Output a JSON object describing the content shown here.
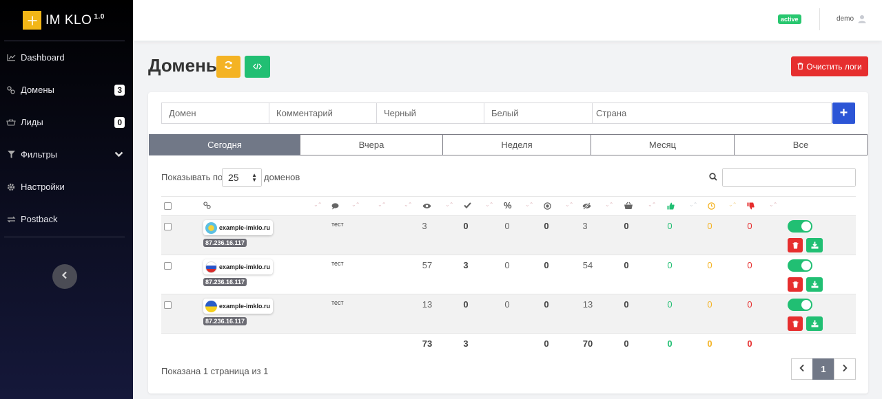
{
  "app": {
    "name": "IM KLO",
    "version": "1.0",
    "brand_color": "#f2b617"
  },
  "sidebar": {
    "items": [
      {
        "label": "Dashboard",
        "icon": "chart-line-icon"
      },
      {
        "label": "Домены",
        "icon": "link-icon",
        "badge": "3"
      },
      {
        "label": "Лиды",
        "icon": "basket-icon",
        "badge": "0"
      },
      {
        "label": "Фильтры",
        "icon": "filter-icon",
        "has_chevron": true
      },
      {
        "label": "Настройки",
        "icon": "gear-icon"
      },
      {
        "label": "Postback",
        "icon": "exchange-icon"
      }
    ]
  },
  "header": {
    "status": "active",
    "user": "demo"
  },
  "page": {
    "title": "Домены",
    "clear_logs_label": "Очистить логи"
  },
  "filters": {
    "domain_placeholder": "Домен",
    "comment_placeholder": "Комментарий",
    "black_placeholder": "Черный",
    "white_placeholder": "Белый",
    "country_placeholder": "Страна",
    "add_label": "+"
  },
  "periods": [
    "Сегодня",
    "Вчера",
    "Неделя",
    "Месяц",
    "Все"
  ],
  "active_period": "Сегодня",
  "table_controls": {
    "show_label": "Показывать по",
    "per_page": "25",
    "domains_label": "доменов"
  },
  "rows": [
    {
      "domain": "example-imklo.ru",
      "flag": "kz",
      "ip": "87.236.16.117",
      "comment": "тест",
      "views": "3",
      "checks": "0",
      "percent": "0",
      "target": "0",
      "hidden": "3",
      "basket": "0",
      "likes": "0",
      "pending": "0",
      "dislikes": "0",
      "enabled": true
    },
    {
      "domain": "example-imklo.ru",
      "flag": "ru",
      "ip": "87.236.16.117",
      "comment": "тест",
      "views": "57",
      "checks": "3",
      "percent": "0",
      "target": "0",
      "hidden": "54",
      "basket": "0",
      "likes": "0",
      "pending": "0",
      "dislikes": "0",
      "enabled": true
    },
    {
      "domain": "example-imklo.ru",
      "flag": "ua",
      "ip": "87.236.16.117",
      "comment": "тест",
      "views": "13",
      "checks": "0",
      "percent": "0",
      "target": "0",
      "hidden": "13",
      "basket": "0",
      "likes": "0",
      "pending": "0",
      "dislikes": "0",
      "enabled": true
    }
  ],
  "totals": {
    "views": "73",
    "checks": "3",
    "target": "0",
    "hidden": "70",
    "basket": "0",
    "likes": "0",
    "pending": "0",
    "dislikes": "0"
  },
  "pagination": {
    "summary": "Показана 1 страница из 1",
    "current": "1"
  },
  "colors": {
    "green": "#21bf73",
    "orange": "#f4b324",
    "red": "#e62e2e",
    "blue": "#2c55d6",
    "gray_active": "#717887"
  }
}
